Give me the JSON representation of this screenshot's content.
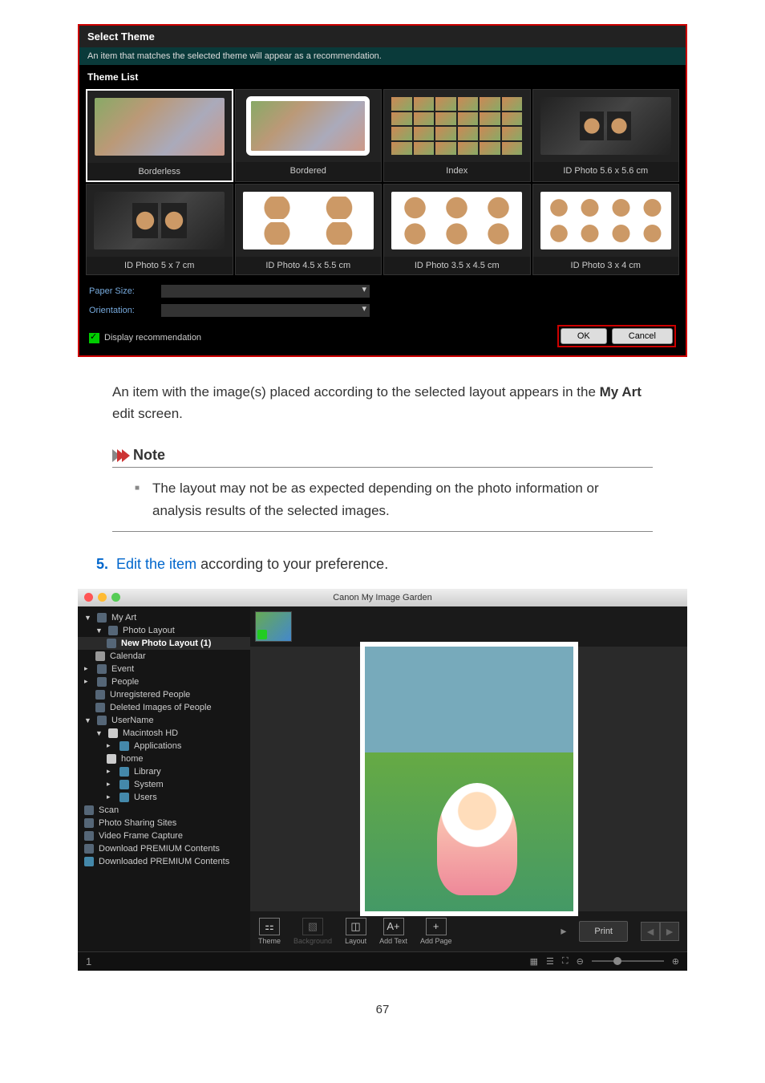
{
  "themeDialog": {
    "title": "Select Theme",
    "subtitle": "An item that matches the selected theme will appear as a recommendation.",
    "listLabel": "Theme List",
    "themes": [
      "Borderless",
      "Bordered",
      "Index",
      "ID Photo 5.6 x 5.6 cm",
      "ID Photo 5 x 7 cm",
      "ID Photo 4.5 x 5.5 cm",
      "ID Photo 3.5 x 4.5 cm",
      "ID Photo 3 x 4 cm"
    ],
    "paperSizeLabel": "Paper Size:",
    "orientationLabel": "Orientation:",
    "displayRec": "Display recommendation",
    "ok": "OK",
    "cancel": "Cancel"
  },
  "para1_a": "An item with the image(s) placed according to the selected layout appears in the ",
  "para1_b": "My Art",
  "para1_c": " edit screen.",
  "note": {
    "title": "Note",
    "item": "The layout may not be as expected depending on the photo information or analysis results of the selected images."
  },
  "step5": {
    "num": "5.",
    "link": "Edit the item",
    "rest": " according to your preference."
  },
  "appWindow": {
    "title": "Canon My Image Garden",
    "tree": [
      "My Art",
      "Photo Layout",
      "New Photo Layout (1)",
      "Calendar",
      "Event",
      "People",
      "Unregistered People",
      "Deleted Images of People",
      "UserName",
      "Macintosh HD",
      "Applications",
      "home",
      "Library",
      "System",
      "Users",
      "Scan",
      "Photo Sharing Sites",
      "Video Frame Capture",
      "Download PREMIUM Contents",
      "Downloaded PREMIUM Contents"
    ],
    "tools": [
      "Theme",
      "Background",
      "Layout",
      "Add Text",
      "Add Page"
    ],
    "print": "Print",
    "statusLeft": "1"
  },
  "pageNum": "67"
}
